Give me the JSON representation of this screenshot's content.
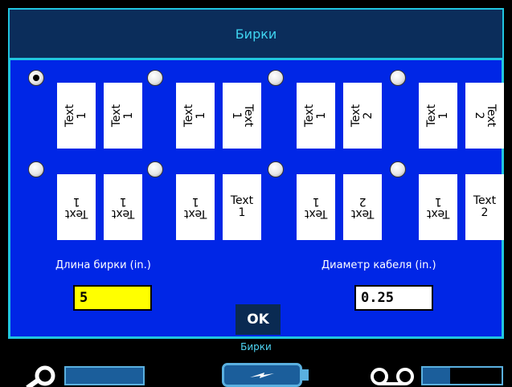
{
  "window": {
    "title": "Бирки"
  },
  "options": [
    {
      "selected": true,
      "tags": [
        {
          "text": "Text\n1",
          "orient": "ccw"
        },
        {
          "text": "Text\n1",
          "orient": "ccw"
        }
      ]
    },
    {
      "selected": false,
      "tags": [
        {
          "text": "Text\n1",
          "orient": "ccw"
        },
        {
          "text": "Text\n1",
          "orient": "cw"
        }
      ]
    },
    {
      "selected": false,
      "tags": [
        {
          "text": "Text\n1",
          "orient": "ccw"
        },
        {
          "text": "Text\n2",
          "orient": "ccw"
        }
      ]
    },
    {
      "selected": false,
      "tags": [
        {
          "text": "Text\n1",
          "orient": "ccw"
        },
        {
          "text": "Text\n2",
          "orient": "cw"
        }
      ]
    },
    {
      "selected": false,
      "tags": [
        {
          "text": "Text\n1",
          "orient": "180"
        },
        {
          "text": "Text\n1",
          "orient": "180"
        }
      ]
    },
    {
      "selected": false,
      "tags": [
        {
          "text": "Text\n1",
          "orient": "180"
        },
        {
          "text": "Text\n1",
          "orient": "none"
        }
      ]
    },
    {
      "selected": false,
      "tags": [
        {
          "text": "Text\n1",
          "orient": "180"
        },
        {
          "text": "Text\n2",
          "orient": "180"
        }
      ]
    },
    {
      "selected": false,
      "tags": [
        {
          "text": "Text\n1",
          "orient": "180"
        },
        {
          "text": "Text\n2",
          "orient": "none"
        }
      ]
    }
  ],
  "fields": {
    "length_label": "Длина бирки (in.)",
    "length_value": "5",
    "diameter_label": "Диаметр кабеля (in.)",
    "diameter_value": "0.25"
  },
  "ok_label": "OK",
  "status": {
    "label": "Бирки"
  },
  "colors": {
    "dialog_bg": "#0026e6",
    "frame": "#20c5e0",
    "input_active": "#ffff00",
    "input": "#ffffff"
  },
  "icons": {
    "tape": "key-icon",
    "battery": "battery-charging-icon",
    "ribbon": "ribbon-cassette-icon"
  },
  "gauges": {
    "tape_level": 1.0,
    "ribbon_level": 0.35
  }
}
